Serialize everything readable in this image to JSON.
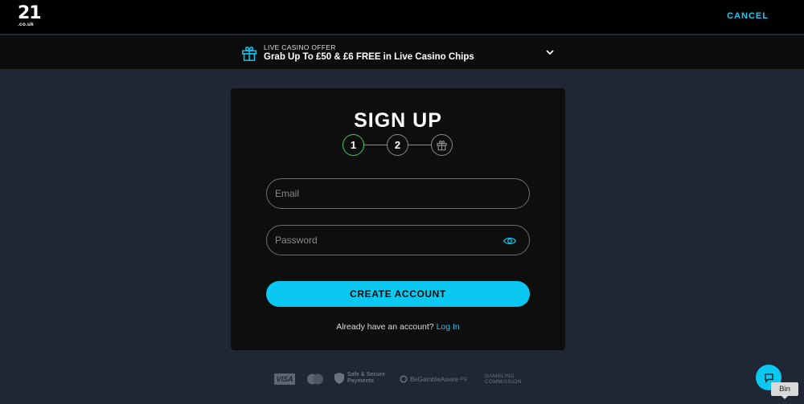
{
  "header": {
    "logo_number": "21",
    "logo_domain": ".co.uk",
    "cancel_label": "CANCEL"
  },
  "offer": {
    "label": "LIVE CASINO OFFER",
    "text": "Grab Up To £50 & £6 FREE in Live Casino Chips",
    "icon": "gift-icon",
    "expand_icon": "chevron-down-icon"
  },
  "signup": {
    "title": "SIGN UP",
    "steps": [
      {
        "label": "1",
        "state": "active"
      },
      {
        "label": "2",
        "state": "pending"
      },
      {
        "label": "",
        "icon": "gift-icon",
        "state": "pending"
      }
    ],
    "email": {
      "placeholder": "Email",
      "value": ""
    },
    "password": {
      "placeholder": "Password",
      "value": ""
    },
    "create_label": "CREATE ACCOUNT",
    "login_prompt": "Already have an account?",
    "login_link": "Log In"
  },
  "footer": {
    "visa": "VISA",
    "safe_line1": "Safe & Secure",
    "safe_line2": "Payments",
    "begambleaware": "BeGambleAware",
    "begambleaware_suffix": ".org",
    "gc_line1": "GAMBLING",
    "gc_line2": "COMMISSION"
  },
  "chat": {
    "icon": "chat-icon",
    "tooltip": "Bin"
  },
  "colors": {
    "accent": "#0bc8f0",
    "step_active": "#37d35c",
    "background": "#1f2734",
    "card": "#0e0e0e"
  }
}
